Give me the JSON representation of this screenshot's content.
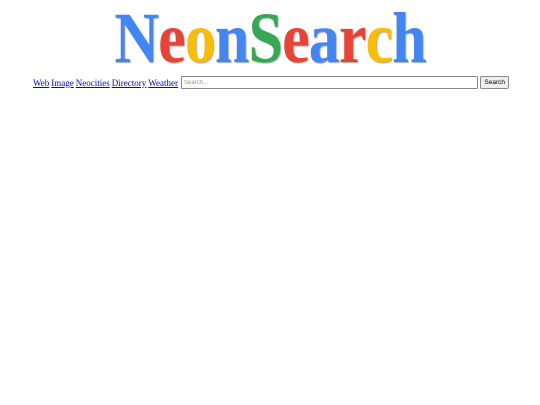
{
  "logo": {
    "letters": [
      {
        "char": "N",
        "color": "#4285f4"
      },
      {
        "char": "e",
        "color": "#ea4335"
      },
      {
        "char": "o",
        "color": "#fbbc05"
      },
      {
        "char": "n",
        "color": "#4285f4"
      },
      {
        "char": "S",
        "color": "#34a853"
      },
      {
        "char": "e",
        "color": "#ea4335"
      },
      {
        "char": "a",
        "color": "#4285f4"
      },
      {
        "char": "r",
        "color": "#ea4335"
      },
      {
        "char": "c",
        "color": "#fbbc05"
      },
      {
        "char": "h",
        "color": "#4285f4"
      }
    ]
  },
  "nav": {
    "links": [
      {
        "label": "Web"
      },
      {
        "label": "Image"
      },
      {
        "label": "Neocities"
      },
      {
        "label": "Directory"
      },
      {
        "label": "Weather"
      }
    ]
  },
  "search": {
    "placeholder": "Search...",
    "value": "",
    "button_label": "Search"
  }
}
